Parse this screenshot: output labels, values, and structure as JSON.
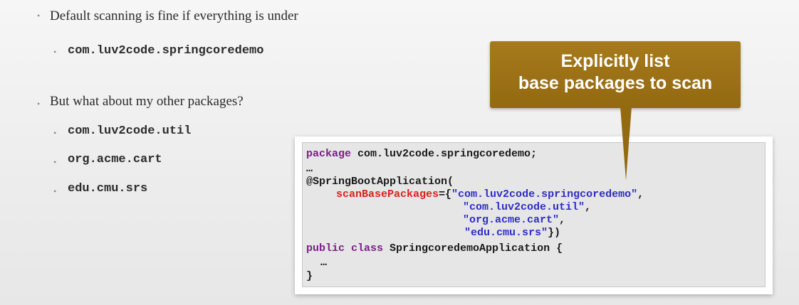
{
  "bullets": {
    "b1": {
      "text": "Default scanning is fine if everything is under"
    },
    "b1_sub": [
      {
        "text": "com.luv2code.springcoredemo"
      }
    ],
    "b2": {
      "text": "But what about my other packages?"
    },
    "b2_sub": [
      {
        "text": "com.luv2code.util"
      },
      {
        "text": "org.acme.cart"
      },
      {
        "text": "edu.cmu.srs"
      }
    ]
  },
  "callout": {
    "line1": "Explicitly list",
    "line2": "base packages to scan",
    "color": "#9a6f16"
  },
  "code": {
    "line1_kw": "package",
    "line1_rest": " com.luv2code.springcoredemo;",
    "line2": "…",
    "line3": "@SpringBootApplication(",
    "line4_attr": "scanBasePackages",
    "line4_eq": "={",
    "line4_str": "\"com.luv2code.springcoredemo\"",
    "line4_end": ",",
    "line5_str": "\"com.luv2code.util\"",
    "line5_end": ",",
    "line6_str": "\"org.acme.cart\"",
    "line6_end": ",",
    "line7_str": "\"edu.cmu.srs\"",
    "line7_end": "})",
    "line8_kw": "public class",
    "line8_rest": " SpringcoredemoApplication {",
    "line9": "…",
    "line10": "}"
  },
  "colors": {
    "keyword": "#7b1f86",
    "annotation_attr": "#d6221b",
    "string": "#2d2cc9"
  }
}
